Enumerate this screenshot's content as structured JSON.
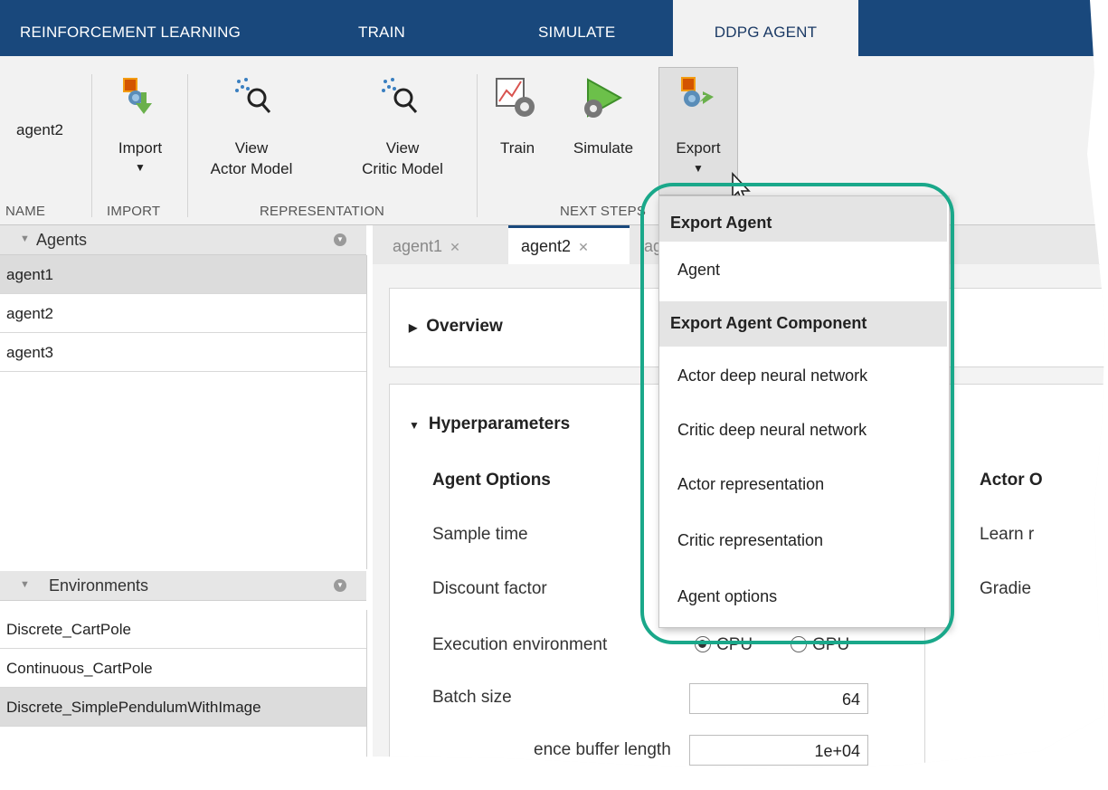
{
  "tabs": [
    "REINFORCEMENT LEARNING",
    "TRAIN",
    "SIMULATE",
    "DDPG AGENT"
  ],
  "toolstrip": {
    "name_value": "agent2",
    "import_label": "Import",
    "view_actor_line1": "View",
    "view_actor_line2": "Actor Model",
    "view_critic_line1": "View",
    "view_critic_line2": "Critic Model",
    "train_label": "Train",
    "simulate_label": "Simulate",
    "export_label": "Export",
    "sections": [
      "NAME",
      "IMPORT",
      "REPRESENTATION",
      "NEXT STEPS"
    ]
  },
  "agents_panel": {
    "title": "Agents",
    "items": [
      "agent1",
      "agent2",
      "agent3"
    ]
  },
  "environments_panel": {
    "title": "Environments",
    "items": [
      "Discrete_CartPole",
      "Continuous_CartPole",
      "Discrete_SimplePendulumWithImage"
    ]
  },
  "doc_tabs": [
    "agent1",
    "agent2",
    "ag"
  ],
  "overview_title": "Overview",
  "hyperparameters": {
    "title": "Hyperparameters",
    "agent_options_title": "Agent Options",
    "sample_time_label": "Sample time",
    "discount_factor_label": "Discount factor",
    "execution_env_label": "Execution environment",
    "cpu_label": "CPU",
    "gpu_label": "GPU",
    "batch_size_label": "Batch size",
    "batch_size_value": "64",
    "buffer_label": "ence buffer length",
    "buffer_value": "1e+04",
    "actor_options_title": "Actor O",
    "learn_rate_label": "Learn r",
    "gradient_label": "Gradie"
  },
  "export_menu": {
    "header1": "Export Agent",
    "item_agent": "Agent",
    "header2": "Export Agent Component",
    "items": [
      "Actor deep neural network",
      "Critic deep neural network",
      "Actor representation",
      "Critic representation",
      "Agent options"
    ]
  },
  "colors": {
    "tabstrip": "#19487c",
    "highlight": "#1aa88a"
  }
}
